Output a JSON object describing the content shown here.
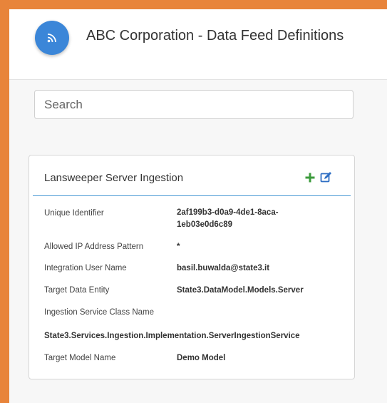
{
  "header": {
    "title": "ABC Corporation - Data Feed Definitions",
    "logo_icon": "rss-feed-icon",
    "logo_color": "#3b86d8"
  },
  "search": {
    "placeholder": "Search"
  },
  "card": {
    "title": "Lansweeper Server Ingestion",
    "accent_color": "#4a9ad4",
    "actions": {
      "add_icon": "plus-icon",
      "add_color": "#3c9b3c",
      "edit_icon": "edit-icon",
      "edit_color": "#2f6fc4"
    },
    "fields": [
      {
        "label": "Unique Identifier",
        "value": "2af199b3-d0a9-4de1-8aca-1eb03e0d6c89"
      },
      {
        "label": "Allowed IP Address Pattern",
        "value": "*"
      },
      {
        "label": "Integration User Name",
        "value": "basil.buwalda@state3.it"
      },
      {
        "label": "Target Data Entity",
        "value": "State3.DataModel.Models.Server"
      },
      {
        "label": "Ingestion Service Class Name",
        "value": "State3.Services.Ingestion.Implementation.ServerIngestionService"
      },
      {
        "label": "Target Model Name",
        "value": "Demo Model"
      }
    ]
  }
}
